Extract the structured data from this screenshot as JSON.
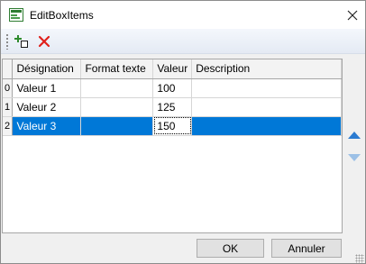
{
  "window": {
    "title": "EditBoxItems"
  },
  "toolbar": {
    "add_icon": "add-item-icon",
    "delete_icon": "delete-icon"
  },
  "grid": {
    "columns": [
      "Désignation",
      "Format texte",
      "Valeur",
      "Description"
    ],
    "rows": [
      {
        "index": "0",
        "designation": "Valeur 1",
        "format": "",
        "valeur": "100",
        "description": ""
      },
      {
        "index": "1",
        "designation": "Valeur 2",
        "format": "",
        "valeur": "125",
        "description": ""
      },
      {
        "index": "2",
        "designation": "Valeur 3",
        "format": "",
        "valeur": "150",
        "description": ""
      }
    ],
    "selected_row": 2
  },
  "buttons": {
    "ok": "OK",
    "cancel": "Annuler"
  },
  "colors": {
    "selection": "#0078d7",
    "arrow_up": "#2b7bd1",
    "arrow_down": "#9cc0e6",
    "delete": "#e0201b"
  }
}
